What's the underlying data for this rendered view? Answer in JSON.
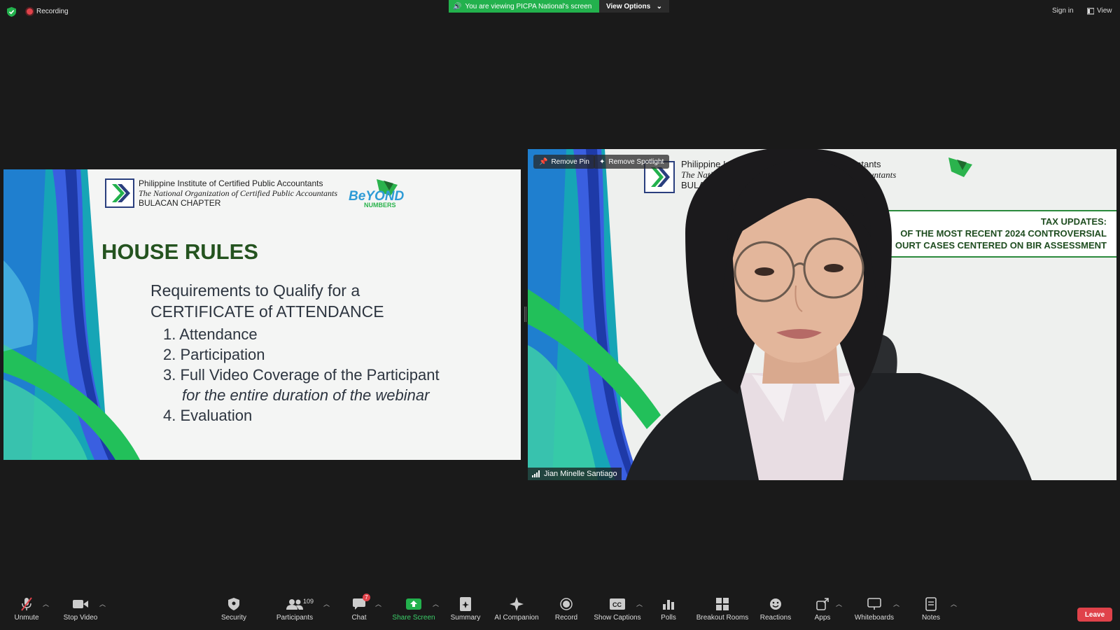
{
  "topbar": {
    "recording_label": "Recording",
    "viewing_banner": "You are viewing PICPA National's screen",
    "view_options": "View Options",
    "sign_in": "Sign in",
    "view": "View"
  },
  "slide": {
    "org_name": "Philippine Institute of Certified Public Accountants",
    "org_tagline": "The National Organization of Certified Public Accountants",
    "org_chapter": "BULACAN CHAPTER",
    "beyond_logo": "BeYOND",
    "beyond_sub": "NUMBERS",
    "title": "HOUSE RULES",
    "requirements_line1": "Requirements to Qualify for a",
    "requirements_line2": "CERTIFICATE of ATTENDANCE",
    "items": [
      "1. Attendance",
      "2. Participation",
      "3. Full Video Coverage of the Participant",
      "for the entire duration of the webinar",
      "4. Evaluation"
    ]
  },
  "video": {
    "remove_pin": "Remove Pin",
    "remove_spotlight": "Remove Spotlight",
    "org_name_partial": "Philippine Inst",
    "org_tag_partial": "The Natio",
    "org_chapter_partial": "BULAC",
    "org_name_end": "Accountants",
    "org_tag_end": "ublic Accountants",
    "tax_line1": "TAX UPDATES:",
    "tax_line2": "OF THE MOST RECENT 2024 CONTROVERSIAL",
    "tax_line3": "OURT CASES CENTERED ON BIR ASSESSMENT",
    "participant_name": "Jian Minelle Santiago"
  },
  "toolbar": {
    "unmute": "Unmute",
    "stop_video": "Stop Video",
    "security": "Security",
    "participants": "Participants",
    "participants_count": "109",
    "chat": "Chat",
    "chat_badge": "7",
    "share_screen": "Share Screen",
    "summary": "Summary",
    "ai_companion": "AI Companion",
    "record": "Record",
    "show_captions": "Show Captions",
    "polls": "Polls",
    "breakout_rooms": "Breakout Rooms",
    "reactions": "Reactions",
    "apps": "Apps",
    "whiteboards": "Whiteboards",
    "notes": "Notes",
    "leave": "Leave"
  },
  "colors": {
    "background": "#1a1a1a",
    "banner_green": "#23b14d",
    "leave_red": "#e0424a",
    "share_green": "#23b14d"
  }
}
